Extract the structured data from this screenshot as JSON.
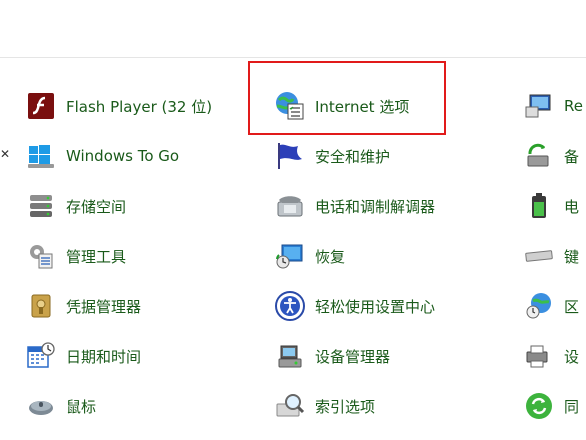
{
  "items": {
    "c1": [
      {
        "label": "Flash Player (32 位)",
        "icon": "flash-player-icon"
      },
      {
        "label": "Windows To Go",
        "icon": "windows-to-go-icon"
      },
      {
        "label": "存储空间",
        "icon": "storage-spaces-icon"
      },
      {
        "label": "管理工具",
        "icon": "admin-tools-icon"
      },
      {
        "label": "凭据管理器",
        "icon": "credential-manager-icon"
      },
      {
        "label": "日期和时间",
        "icon": "date-time-icon"
      },
      {
        "label": "鼠标",
        "icon": "mouse-icon"
      }
    ],
    "c2": [
      {
        "label": "Internet 选项",
        "icon": "internet-options-icon"
      },
      {
        "label": "安全和维护",
        "icon": "security-maintenance-icon"
      },
      {
        "label": "电话和调制解调器",
        "icon": "phone-modem-icon"
      },
      {
        "label": "恢复",
        "icon": "recovery-icon"
      },
      {
        "label": "轻松使用设置中心",
        "icon": "ease-of-access-icon"
      },
      {
        "label": "设备管理器",
        "icon": "device-manager-icon"
      },
      {
        "label": "索引选项",
        "icon": "indexing-options-icon"
      }
    ],
    "c3": [
      {
        "label": "Re",
        "icon": "remote-app-icon"
      },
      {
        "label": "备",
        "icon": "backup-icon"
      },
      {
        "label": "电",
        "icon": "power-options-icon"
      },
      {
        "label": "键",
        "icon": "keyboard-icon"
      },
      {
        "label": "区",
        "icon": "region-icon"
      },
      {
        "label": "设",
        "icon": "devices-printers-icon"
      },
      {
        "label": "同",
        "icon": "sync-center-icon"
      }
    ]
  },
  "colors": {
    "link": "#1a5a1a",
    "highlight": "#e11a1a"
  }
}
